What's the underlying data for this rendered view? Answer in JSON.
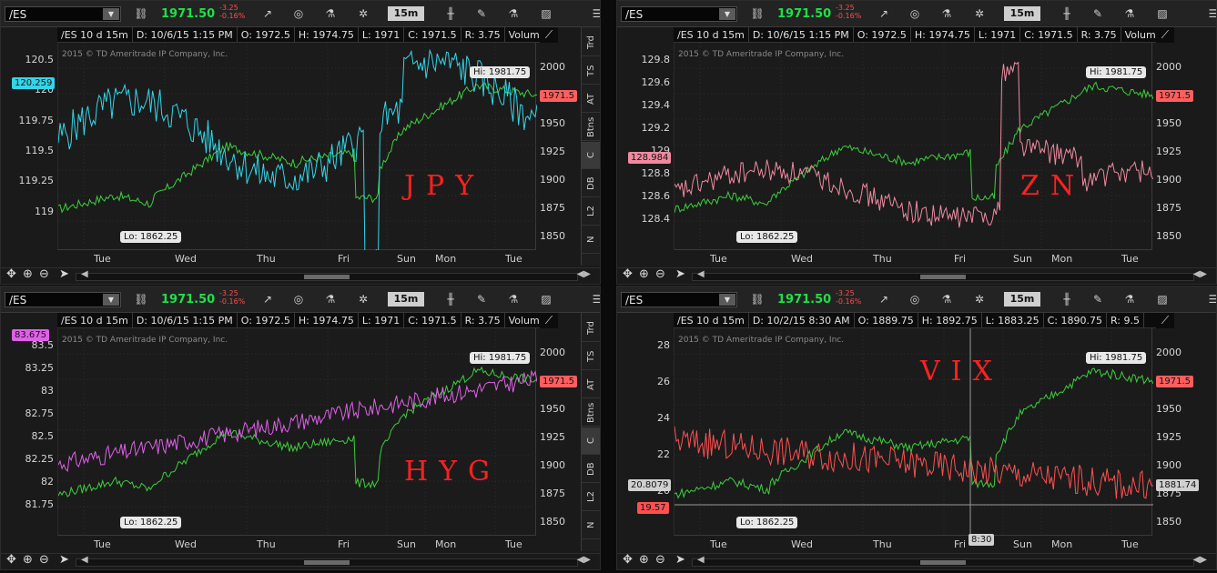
{
  "panels": [
    {
      "symbol": "/ES",
      "price": "1971.50",
      "change": "-3.25",
      "change_pct": "-0.16%",
      "timeframe": "15m",
      "info": [
        "/ES 10 d 15m",
        "D: 10/6/15 1:15 PM",
        "O: 1972.5",
        "H: 1974.75",
        "L: 1971",
        "C: 1971.5",
        "R: 3.75",
        "Volume"
      ],
      "copyright": "2015 © TD Ameritrade IP Company, Inc.",
      "hi": "Hi: 1981.75",
      "lo": "Lo: 1862.25",
      "overlay_tag": "120.259",
      "es_tag": "1971.5",
      "left_axis": [
        "120.5",
        "120",
        "119.75",
        "119.5",
        "119.25",
        "119"
      ],
      "left_extra": "120.259",
      "right_axis": [
        "2000",
        "1975",
        "1950",
        "1925",
        "1900",
        "1875",
        "1850"
      ],
      "days": [
        "Tue",
        "Wed",
        "Thu",
        "Fri",
        "Sun",
        "Mon",
        "Tue"
      ],
      "annotation": "JPY",
      "overlay_color": "#33d6e8"
    },
    {
      "symbol": "/ES",
      "price": "1971.50",
      "change": "-3.25",
      "change_pct": "-0.16%",
      "timeframe": "15m",
      "info": [
        "/ES 10 d 15m",
        "D: 10/6/15 1:15 PM",
        "O: 1972.5",
        "H: 1974.75",
        "L: 1971",
        "C: 1971.5",
        "R: 3.75",
        "Volume"
      ],
      "copyright": "2015 © TD Ameritrade IP Company, Inc.",
      "hi": "Hi: 1981.75",
      "lo": "Lo: 1862.25",
      "overlay_tag": "128.984",
      "es_tag": "1971.5",
      "left_axis": [
        "129.8",
        "129.6",
        "129.4",
        "129.2",
        "129",
        "128.8",
        "128.6",
        "128.4"
      ],
      "right_axis": [
        "2000",
        "1975",
        "1950",
        "1925",
        "1900",
        "1875",
        "1850"
      ],
      "days": [
        "Tue",
        "Wed",
        "Thu",
        "Fri",
        "Sun",
        "Mon",
        "Tue"
      ],
      "annotation": "ZN",
      "overlay_color": "#f08aa0"
    },
    {
      "symbol": "/ES",
      "price": "1971.50",
      "change": "-3.25",
      "change_pct": "-0.16%",
      "timeframe": "15m",
      "info": [
        "/ES 10 d 15m",
        "D: 10/6/15 1:15 PM",
        "O: 1972.5",
        "H: 1974.75",
        "L: 1971",
        "C: 1971.5",
        "R: 3.75",
        "Volume"
      ],
      "copyright": "2015 © TD Ameritrade IP Company, Inc.",
      "hi": "Hi: 1981.75",
      "lo": "Lo: 1862.25",
      "overlay_tag": "83.675",
      "es_tag": "1971.5",
      "left_axis": [
        "83.5",
        "83.25",
        "83",
        "82.75",
        "82.5",
        "82.25",
        "82",
        "81.75"
      ],
      "right_axis": [
        "2000",
        "1975",
        "1950",
        "1925",
        "1900",
        "1875",
        "1850"
      ],
      "days": [
        "Tue",
        "Wed",
        "Thu",
        "Fri",
        "Sun",
        "Mon",
        "Tue"
      ],
      "annotation": "HYG",
      "overlay_color": "#e060e8"
    },
    {
      "symbol": "/ES",
      "price": "1971.50",
      "change": "-3.25",
      "change_pct": "-0.16%",
      "timeframe": "15m",
      "info": [
        "/ES 10 d 15m",
        "D: 10/2/15 8:30 AM",
        "O: 1889.75",
        "H: 1892.75",
        "L: 1883.25",
        "C: 1890.75",
        "R: 9.5"
      ],
      "copyright": "2015 © TD Ameritrade IP Company, Inc.",
      "hi": "Hi: 1981.75",
      "lo": "Lo: 1862.25",
      "overlay_tag": "19.57",
      "es_tag": "1971.5",
      "cross_left": "20.8079",
      "cross_right": "1881.74",
      "cross_time": "8:30",
      "left_axis": [
        "28",
        "26",
        "24",
        "22",
        "20"
      ],
      "right_axis": [
        "2000",
        "1975",
        "1950",
        "1925",
        "1900",
        "1875",
        "1850"
      ],
      "days": [
        "Tue",
        "Wed",
        "Thu",
        "Fri",
        "Sun",
        "Mon",
        "Tue"
      ],
      "annotation": "VIX",
      "overlay_color": "#ff5050"
    }
  ],
  "side_tabs": [
    "Trd",
    "TS",
    "AT",
    "Btns",
    "C",
    "DB",
    "L2",
    "N"
  ],
  "chart_data": [
    {
      "type": "line",
      "series": [
        {
          "name": "/ES",
          "values": [
            1862.25,
            1971.5,
            1981.75
          ]
        },
        {
          "name": "JPY",
          "values": [
            119,
            120.5,
            120.259
          ]
        }
      ]
    },
    {
      "type": "line",
      "series": [
        {
          "name": "/ES",
          "values": [
            1862.25,
            1971.5,
            1981.75
          ]
        },
        {
          "name": "ZN",
          "values": [
            128.4,
            129.8,
            128.984
          ]
        }
      ]
    },
    {
      "type": "line",
      "series": [
        {
          "name": "/ES",
          "values": [
            1862.25,
            1971.5,
            1981.75
          ]
        },
        {
          "name": "HYG",
          "values": [
            81.75,
            83.5,
            83.675
          ]
        }
      ]
    },
    {
      "type": "line",
      "series": [
        {
          "name": "/ES",
          "values": [
            1862.25,
            1971.5,
            1981.75
          ]
        },
        {
          "name": "VIX",
          "values": [
            20,
            28,
            19.57
          ]
        }
      ]
    }
  ]
}
